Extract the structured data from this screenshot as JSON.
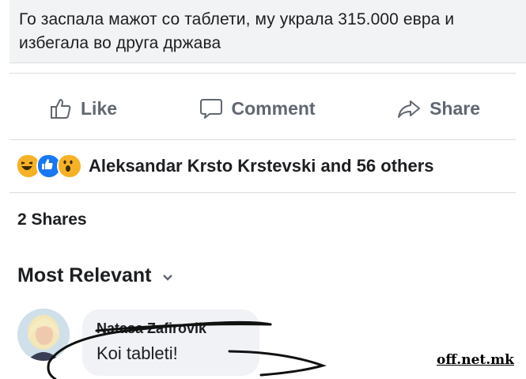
{
  "post": {
    "headline": "Го заспала мажот со таблети, му украла 315.000 евра и избегала во друга држава"
  },
  "actions": {
    "like_label": "Like",
    "comment_label": "Comment",
    "share_label": "Share"
  },
  "reactions": {
    "icons": [
      "haha-icon",
      "like-icon",
      "wow-icon"
    ],
    "summary": "Aleksandar Krsto Krstevski and 56 others"
  },
  "shares": {
    "label": "2 Shares"
  },
  "comments": {
    "sort_label": "Most Relevant",
    "items": [
      {
        "author": "Natasa Zafirovik",
        "text": "Koi tableti!"
      }
    ]
  },
  "watermark": "off.net.mk",
  "colors": {
    "action_gray": "#606770",
    "like_blue": "#1877f2",
    "haha_yellow": "#f7b125",
    "bubble_bg": "#f0f2f5"
  }
}
